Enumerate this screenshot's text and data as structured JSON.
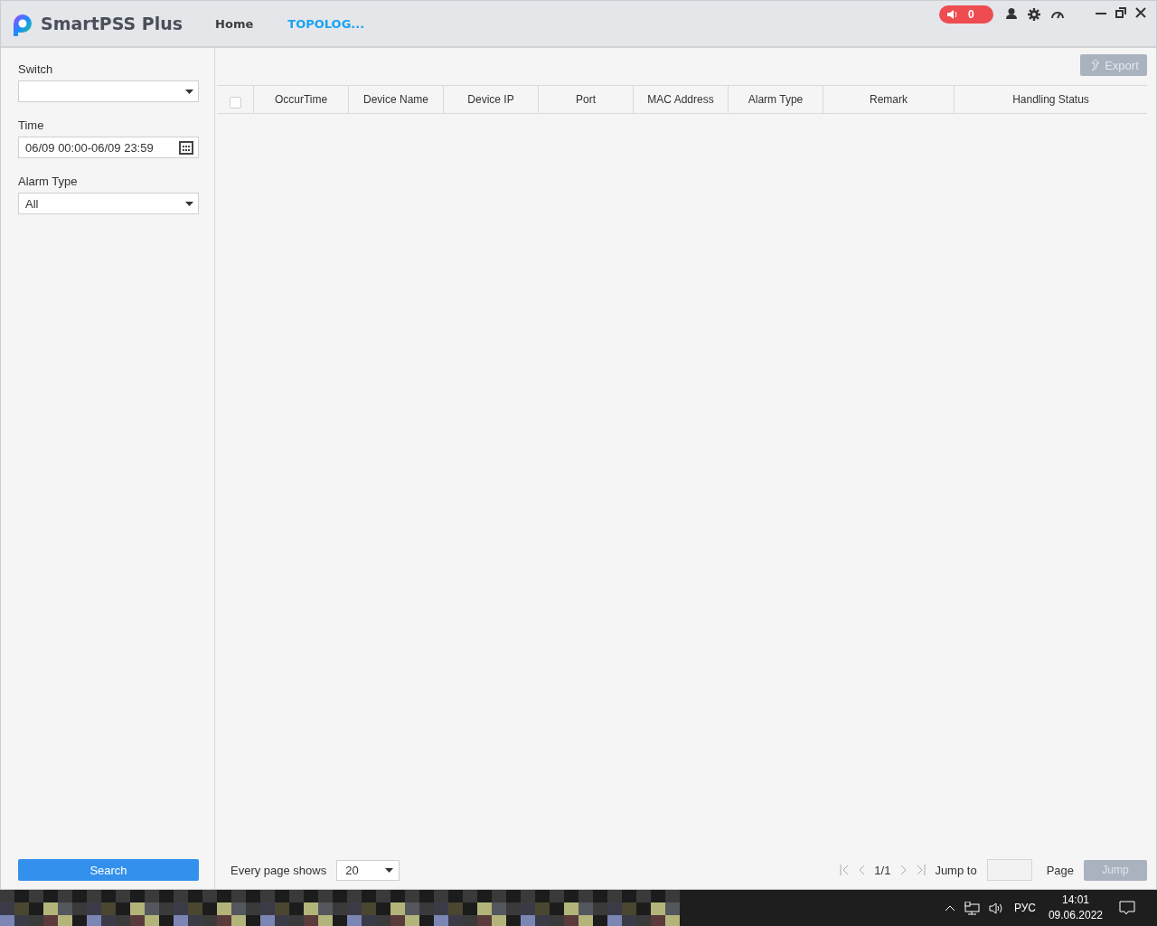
{
  "app": {
    "name": "SmartPSS Plus",
    "alarm_count": "0"
  },
  "nav": [
    {
      "label": "Home",
      "selected": false
    },
    {
      "label": "TOPOLOG...",
      "selected": true
    }
  ],
  "filters": [
    {
      "kind": "select",
      "label": "Switch"
    },
    {
      "kind": "date",
      "label": "Time",
      "value": "06/09 00:00-06/09 23:59"
    },
    {
      "kind": "select",
      "label": "Alarm Type",
      "value": "All"
    }
  ],
  "search_button": "Search",
  "export": {
    "label": "Export",
    "disabled": true
  },
  "table": {
    "select_all_checked": false,
    "columns": [
      "OccurTime",
      "Device Name",
      "Device IP",
      "Port",
      "MAC Address",
      "Alarm Type",
      "Remark",
      "Handling Status"
    ]
  },
  "pagination": {
    "page_size_label": "Every page shows",
    "page_size": "20",
    "page": "1/1",
    "jump_label": "Jump to",
    "page_label": "Page",
    "jump_button": {
      "label": "Jump",
      "disabled": true
    }
  },
  "taskbar": {
    "language": "РУС",
    "time": "14:01",
    "date": "09.06.2022"
  }
}
